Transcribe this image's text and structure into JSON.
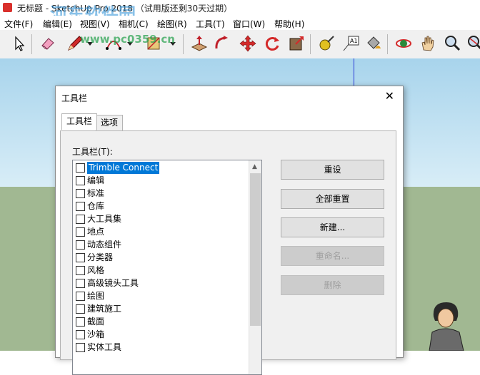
{
  "window": {
    "title": "无标题 - SketchUp Pro 2018 （试用版还剩30天过期）",
    "watermark": "河东软件园",
    "watermark_url": "www.pc0359.cn"
  },
  "menubar": [
    {
      "label": "文件(F)"
    },
    {
      "label": "编辑(E)"
    },
    {
      "label": "视图(V)"
    },
    {
      "label": "相机(C)"
    },
    {
      "label": "绘图(R)"
    },
    {
      "label": "工具(T)"
    },
    {
      "label": "窗口(W)"
    },
    {
      "label": "帮助(H)"
    }
  ],
  "toolbar": {
    "tools": [
      "select-icon",
      "eraser-icon",
      "pencil-icon",
      "arc-icon",
      "rectangle-icon",
      "push-pull-icon",
      "follow-me-icon",
      "move-icon",
      "rotate-icon",
      "offset-icon",
      "tape-measure-icon",
      "text-icon",
      "paint-bucket-icon",
      "orbit-icon",
      "pan-icon",
      "zoom-icon",
      "zoom-extents-icon"
    ]
  },
  "dialog": {
    "title": "工具栏",
    "close": "✕",
    "tabs": [
      {
        "label": "工具栏"
      },
      {
        "label": "选项"
      }
    ],
    "list_label": "工具栏(T):",
    "items": [
      {
        "label": "Trimble Connect",
        "checked": false,
        "selected": true
      },
      {
        "label": "编辑",
        "checked": false
      },
      {
        "label": "标准",
        "checked": false
      },
      {
        "label": "仓库",
        "checked": false
      },
      {
        "label": "大工具集",
        "checked": false
      },
      {
        "label": "地点",
        "checked": false
      },
      {
        "label": "动态组件",
        "checked": false
      },
      {
        "label": "分类器",
        "checked": false
      },
      {
        "label": "风格",
        "checked": false
      },
      {
        "label": "高级镜头工具",
        "checked": false
      },
      {
        "label": "绘图",
        "checked": false
      },
      {
        "label": "建筑施工",
        "checked": false
      },
      {
        "label": "截面",
        "checked": false
      },
      {
        "label": "沙箱",
        "checked": false
      },
      {
        "label": "实体工具",
        "checked": false
      }
    ],
    "buttons": [
      {
        "label": "重设",
        "enabled": true
      },
      {
        "label": "全部重置",
        "enabled": true
      },
      {
        "label": "新建...",
        "enabled": true
      },
      {
        "label": "重命名...",
        "enabled": false
      },
      {
        "label": "删除",
        "enabled": false
      }
    ]
  },
  "colors": {
    "sky": "#a8d4ec",
    "ground": "#a1b892",
    "selection": "#0078d7"
  }
}
